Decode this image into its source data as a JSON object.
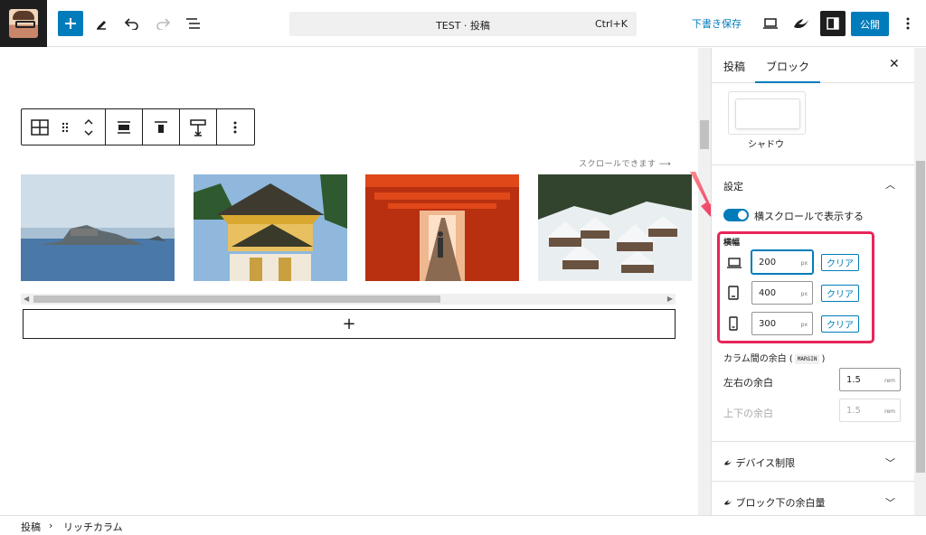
{
  "topbar": {
    "command_title": "TEST · 投稿",
    "command_shortcut": "Ctrl+K",
    "save_draft": "下書き保存",
    "publish": "公開"
  },
  "editor": {
    "scroll_hint": "スクロールできます ⟶",
    "appender_symbol": "+",
    "images": [
      {
        "alt": "island"
      },
      {
        "alt": "shrine gate"
      },
      {
        "alt": "torii path"
      },
      {
        "alt": "snow village"
      }
    ]
  },
  "sidebar": {
    "tab_post": "投稿",
    "tab_block": "ブロック",
    "shadow_label": "シャドウ",
    "settings_title": "設定",
    "toggle_label": "横スクロールで表示する",
    "toggle_on": true,
    "width_title": "横幅",
    "widths": [
      {
        "device": "desktop-icon",
        "value": "200",
        "unit": "px",
        "clear": "クリア"
      },
      {
        "device": "tablet-icon",
        "value": "400",
        "unit": "px",
        "clear": "クリア"
      },
      {
        "device": "mobile-icon",
        "value": "300",
        "unit": "px",
        "clear": "クリア"
      }
    ],
    "margin_label_prefix": "カラム間の余白 (",
    "margin_tag": "MARGIN",
    "margin_label_suffix": ")",
    "lr_label": "左右の余白",
    "lr_value": "1.5",
    "lr_unit": "rem",
    "tb_label": "上下の余白",
    "tb_value": "1.5",
    "tb_unit": "rem",
    "device_limit": "デバイス制限",
    "block_bottom_margin": "ブロック下の余白量"
  },
  "footer": {
    "crumb1": "投稿",
    "crumb2": "リッチカラム"
  },
  "colors": {
    "accent": "#007cba",
    "highlight": "#e7255a",
    "dark": "#1e1e1e"
  }
}
